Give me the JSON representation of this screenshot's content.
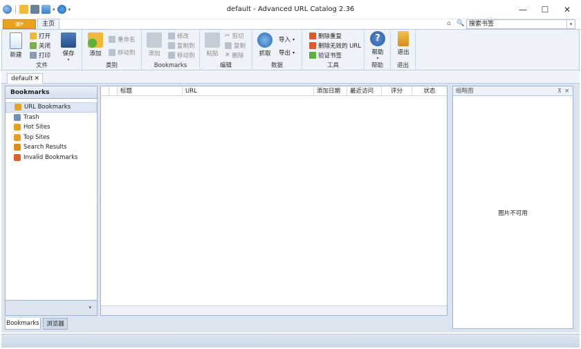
{
  "window": {
    "title": "default - Advanced URL Catalog 2.36",
    "minimize": "—",
    "maximize": "☐",
    "close": "✕"
  },
  "app_menu_label": "▥▾",
  "tabs": {
    "home": "主页"
  },
  "search": {
    "placeholder": "搜索书签",
    "value": "搜索书签"
  },
  "ribbon": {
    "file": {
      "label": "文件",
      "new": "新建",
      "open": "打开",
      "close": "关闭",
      "print": "打印",
      "save": "保存"
    },
    "category": {
      "label": "类别",
      "add": "添加",
      "rename": "重命名",
      "move_to": "移动到"
    },
    "bookmarks": {
      "label": "Bookmarks",
      "add": "添加",
      "modify": "修改",
      "copy_to": "复制到",
      "move_to": "移动到"
    },
    "edit": {
      "label": "编辑",
      "paste": "粘贴",
      "cut": "剪切",
      "copy": "复制",
      "delete": "删除"
    },
    "data": {
      "label": "数据",
      "fetch": "抓取",
      "import": "导入",
      "export": "导出"
    },
    "tools": {
      "label": "工具",
      "delete_duplicates": "删除重复",
      "delete_invalid": "删除无效的 URL",
      "verify": "验证书签"
    },
    "help": {
      "label": "帮助",
      "help": "帮助"
    },
    "exit": {
      "label": "退出",
      "exit": "退出"
    }
  },
  "doc_tab": {
    "label": "default",
    "close": "✕"
  },
  "left_panel": {
    "title": "Bookmarks",
    "items": [
      {
        "label": "URL Bookmarks",
        "icon": "folder-star-icon",
        "color": "#e8a020"
      },
      {
        "label": "Trash",
        "icon": "trash-icon",
        "color": "#6f8fb3"
      },
      {
        "label": "Hot Sites",
        "icon": "hot-folder-icon",
        "color": "#e8a020"
      },
      {
        "label": "Top Sites",
        "icon": "top-folder-icon",
        "color": "#e8a020"
      },
      {
        "label": "Search Results",
        "icon": "search-icon",
        "color": "#d98c1c"
      },
      {
        "label": "Invalid Bookmarks",
        "icon": "invalid-folder-icon",
        "color": "#e0602a"
      }
    ],
    "footer_dropdown": "▾",
    "bottom_tabs": [
      "Bookmarks",
      "浏览器"
    ]
  },
  "list": {
    "columns": [
      "标题",
      "URL",
      "添加日期",
      "最近访问",
      "评分",
      "状态"
    ]
  },
  "thumbnail_panel": {
    "title": "缩略图",
    "pin": "⊼",
    "close": "✕",
    "empty_text": "图片不可用"
  }
}
